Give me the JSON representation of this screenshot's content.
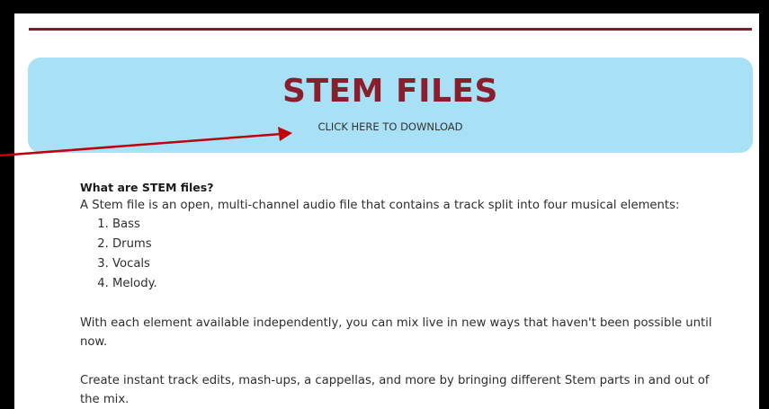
{
  "hero": {
    "title": "STEM FILES",
    "download_link": "CLICK HERE TO DOWNLOAD"
  },
  "content": {
    "question": "What are STEM files?",
    "intro": "A Stem file is an open, multi-channel audio file that contains a track split into four musical elements:",
    "elements": [
      "Bass",
      "Drums",
      "Vocals",
      "Melody."
    ],
    "paragraph_1": "With each element available independently, you can mix live in new ways that haven't been possible until now.",
    "paragraph_2": "Create instant track edits, mash-ups, a cappellas, and more by bringing different Stem parts in and out of the mix."
  },
  "colors": {
    "accent": "#8b1e2c",
    "hero_background": "#a8e1f6",
    "annotation_arrow": "#c0000a"
  }
}
